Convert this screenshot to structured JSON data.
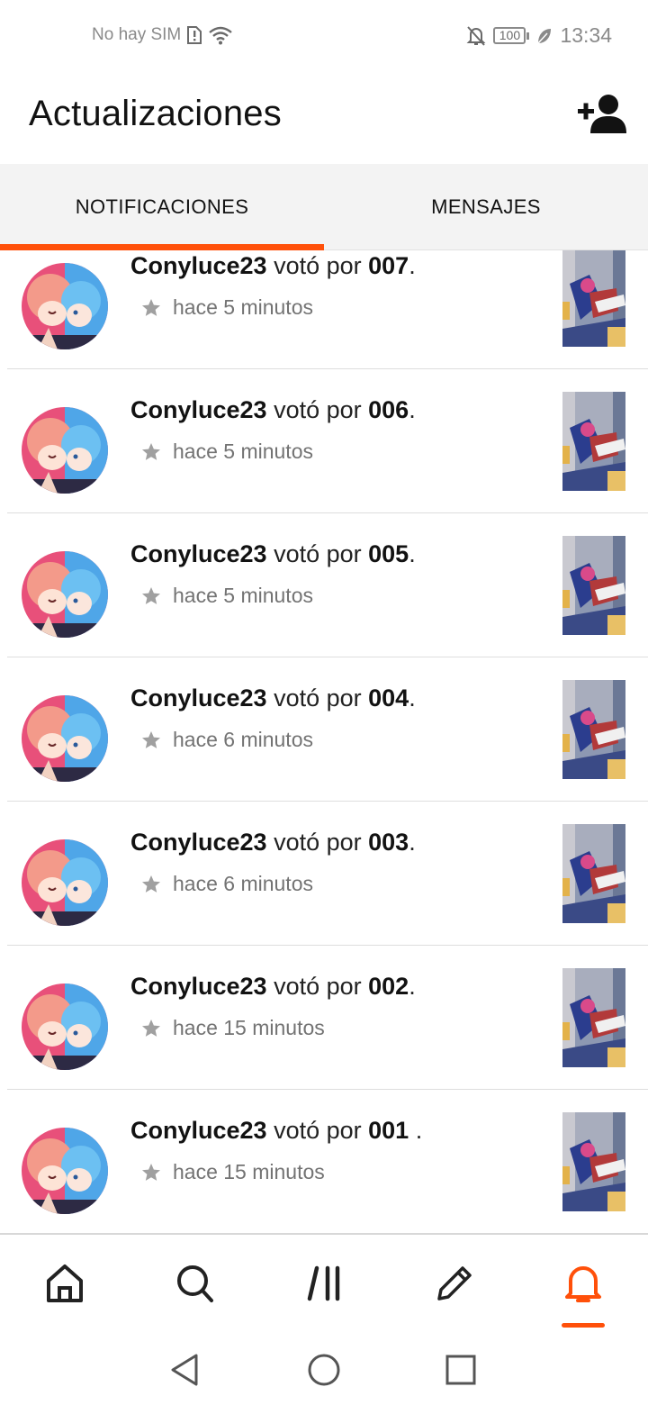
{
  "status_bar": {
    "carrier": "No hay SIM",
    "battery": "100",
    "time": "13:34",
    "icons": [
      "sim-alert-icon",
      "wifi-icon",
      "bell-off-icon",
      "battery-icon",
      "leaf-icon"
    ]
  },
  "header": {
    "title": "Actualizaciones",
    "action_icon": "add-person-icon"
  },
  "tabs": [
    {
      "label": "NOTIFICACIONES",
      "active": true
    },
    {
      "label": "MENSAJES",
      "active": false
    }
  ],
  "colors": {
    "accent": "#ff500a",
    "text": "#121212",
    "muted": "#737373",
    "tab_bg": "#f3f3f3"
  },
  "notifications": [
    {
      "user": "Conyluce23",
      "verb": " votó por ",
      "part": "007",
      "suffix": ".",
      "time": "hace 5 minutos"
    },
    {
      "user": "Conyluce23",
      "verb": " votó por ",
      "part": "006",
      "suffix": ".",
      "time": "hace 5 minutos"
    },
    {
      "user": "Conyluce23",
      "verb": " votó por ",
      "part": "005",
      "suffix": ".",
      "time": "hace 5 minutos"
    },
    {
      "user": "Conyluce23",
      "verb": " votó por ",
      "part": "004",
      "suffix": ".",
      "time": "hace 6 minutos"
    },
    {
      "user": "Conyluce23",
      "verb": " votó por ",
      "part": "003",
      "suffix": ".",
      "time": "hace 6 minutos"
    },
    {
      "user": "Conyluce23",
      "verb": " votó por ",
      "part": "002",
      "suffix": ".",
      "time": "hace 15 minutos"
    },
    {
      "user": "Conyluce23",
      "verb": " votó por ",
      "part": "001 ",
      "suffix": ".",
      "time": "hace 15 minutos"
    }
  ],
  "bottom_nav": [
    {
      "icon": "home-icon",
      "active": false
    },
    {
      "icon": "search-icon",
      "active": false
    },
    {
      "icon": "library-icon",
      "active": false
    },
    {
      "icon": "pencil-icon",
      "active": false
    },
    {
      "icon": "bell-icon",
      "active": true
    }
  ],
  "system_nav": [
    "back-icon",
    "home-circle-icon",
    "recents-icon"
  ]
}
